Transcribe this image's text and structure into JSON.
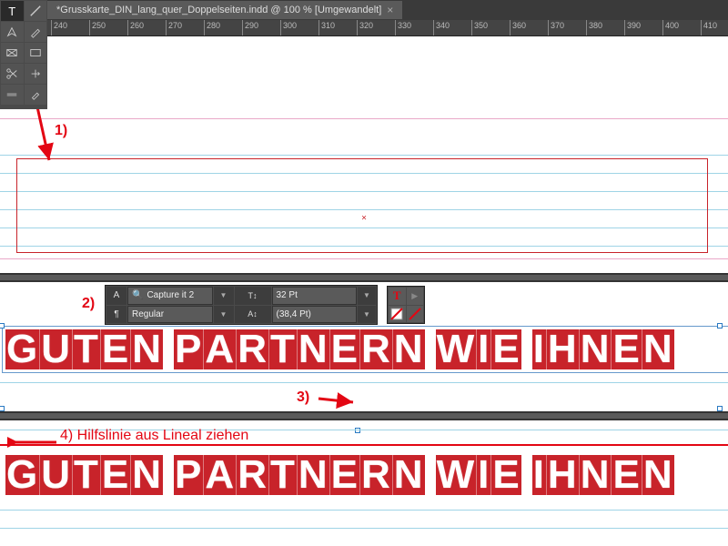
{
  "app": {
    "document_tab": "*Grusskarte_DIN_lang_quer_Doppelseiten.indd @ 100 % [Umgewandelt]",
    "ruler_marks": [
      240,
      250,
      260,
      270,
      280,
      290,
      300,
      310,
      320,
      330,
      340,
      350,
      360,
      370,
      380,
      390,
      400,
      410
    ]
  },
  "annotations": {
    "a1": "1)",
    "a2": "2)",
    "a3": "3)",
    "a4": "4) Hilfslinie aus Lineal ziehen"
  },
  "character_panel": {
    "font_family": "Capture it 2",
    "font_style": "Regular",
    "font_size": "32 Pt",
    "leading": "(38,4 Pt)"
  },
  "headline": {
    "words": [
      "GUTEN",
      "PARTNERN",
      "WIE",
      "IHNEN"
    ]
  },
  "colors": {
    "brand_red": "#c8232a",
    "anno_red": "#e30613"
  }
}
